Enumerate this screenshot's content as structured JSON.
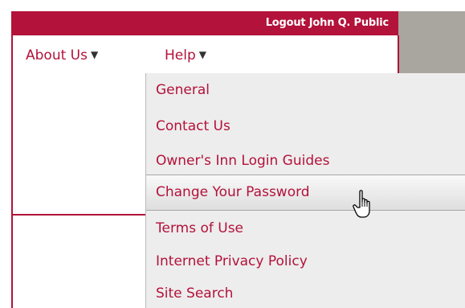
{
  "header": {
    "logout_label": "Logout John Q. Public"
  },
  "nav": {
    "about_label": "About Us",
    "help_label": "Help",
    "caret": "▼"
  },
  "help_menu": {
    "items": [
      {
        "label": "General"
      },
      {
        "label": "Contact Us"
      },
      {
        "label": "Owner's Inn Login Guides"
      },
      {
        "label": "Change Your Password",
        "highlighted": true
      },
      {
        "label": "Terms of Use"
      },
      {
        "label": "Internet Privacy Policy"
      },
      {
        "label": "Site Search"
      }
    ]
  },
  "cursor": {
    "icon": "hand-pointer-icon"
  },
  "colors": {
    "brand": "#b3123a",
    "menu_bg": "#ededed",
    "side_panel": "#a8a69f"
  }
}
